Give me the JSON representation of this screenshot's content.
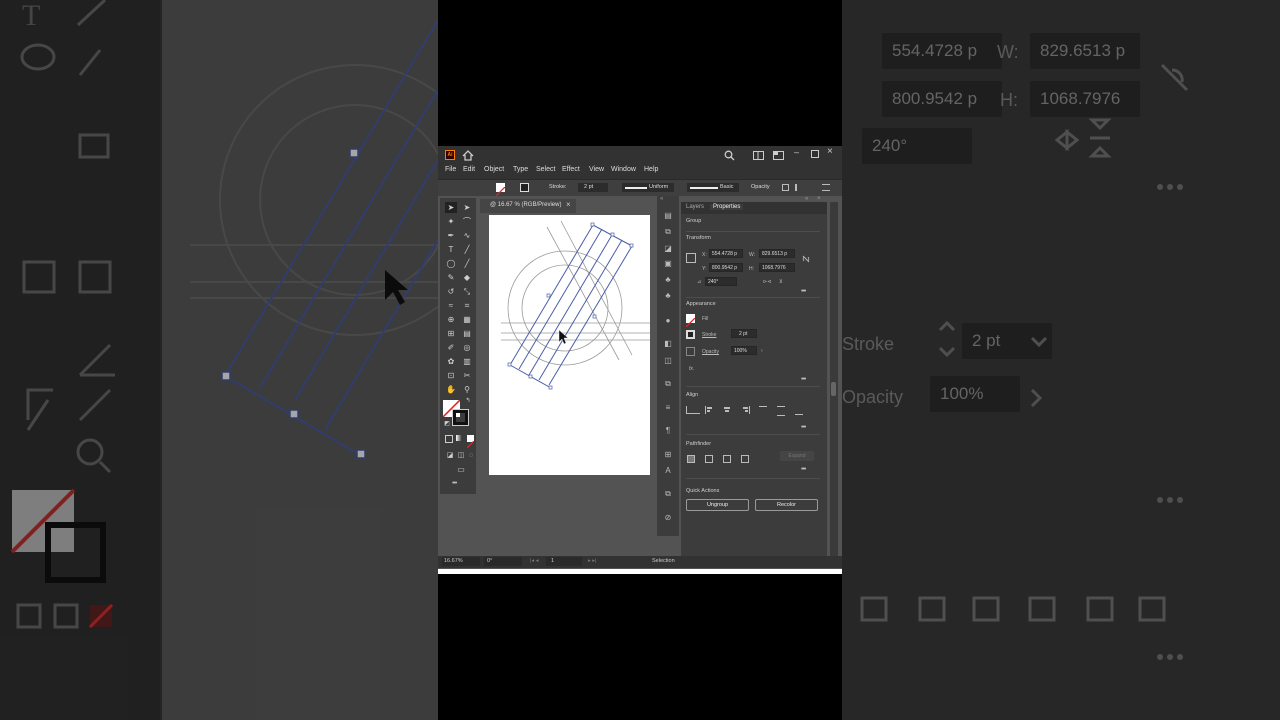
{
  "background_right": {
    "x_value": "554.4728 p",
    "w_label": "W:",
    "w_value": "829.6513 p",
    "y_value": "800.9542 p",
    "h_label": "H:",
    "h_value": "1068.7976",
    "angle_value": "240°",
    "stroke_label": "Stroke",
    "stroke_weight": "2 pt",
    "opacity_label": "Opacity",
    "opacity_value": "100%"
  },
  "menubar": {
    "items": [
      "File",
      "Edit",
      "Object",
      "Type",
      "Select",
      "Effect",
      "View",
      "Window",
      "Help"
    ]
  },
  "controlbar": {
    "stroke_label": "Stroke:",
    "stroke_weight": "2 pt",
    "profile": "Uniform",
    "brush": "Basic",
    "opacity_label": "Opacity"
  },
  "document": {
    "tab_title": "@ 16.67 % (RGB/Preview)",
    "close": "×"
  },
  "statusbar": {
    "zoom": "16.67%",
    "rotation": "0°",
    "artboard": "1",
    "tool": "Selection"
  },
  "panel": {
    "tabs": [
      "Layers",
      "Properties"
    ],
    "selection_type": "Group",
    "transform": {
      "heading": "Transform",
      "x_label": "X:",
      "x_value": "554.4728 p",
      "w_label": "W:",
      "w_value": "829.6513 p",
      "y_label": "Y:",
      "y_value": "800.9542 p",
      "h_label": "H:",
      "h_value": "1068.7976",
      "angle_value": "240°"
    },
    "appearance": {
      "heading": "Appearance",
      "fill_label": "Fill",
      "stroke_label": "Stroke",
      "stroke_weight": "2 pt",
      "opacity_label": "Opacity",
      "opacity_value": "100%",
      "fx": "fx."
    },
    "align": {
      "heading": "Align"
    },
    "pathfinder": {
      "heading": "Pathfinder",
      "expand": "Expand"
    },
    "quick_actions": {
      "heading": "Quick Actions",
      "ungroup": "Ungroup",
      "recolor": "Recolor"
    }
  },
  "colors": {
    "ui_dark": "#323232",
    "panel": "#3c3c3c",
    "canvas": "#535353",
    "path_blue": "#4a5fa8",
    "none_red": "#d62a2a"
  }
}
